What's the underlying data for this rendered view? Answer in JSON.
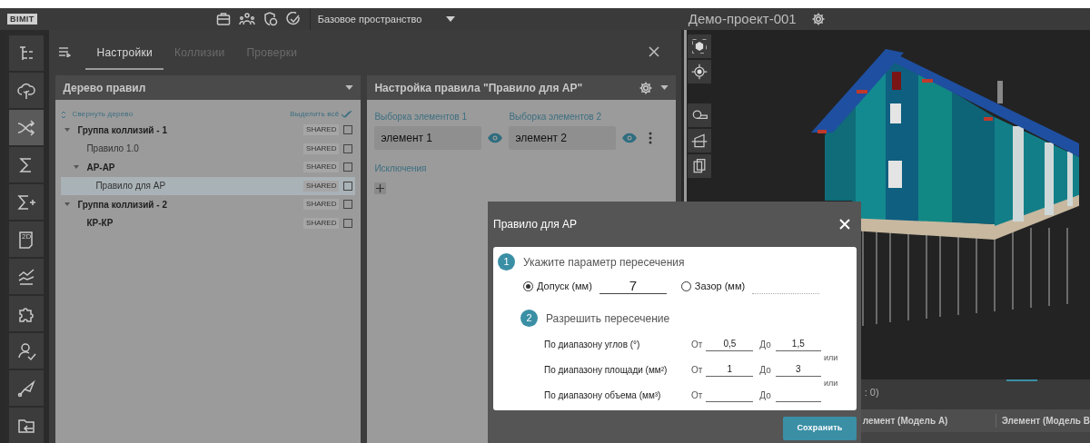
{
  "topbar": {
    "logo": "BIMIT",
    "workspace": "Базовое пространство",
    "project": "Демо-проект-001"
  },
  "rail": [
    {
      "kind": "tree",
      "selected": false
    },
    {
      "kind": "cloud",
      "selected": false
    },
    {
      "kind": "shuffle",
      "selected": true
    },
    {
      "kind": "sigma",
      "selected": false
    },
    {
      "kind": "sigmaplus",
      "selected": false
    },
    {
      "kind": "sheet",
      "label": "2D",
      "selected": false
    },
    {
      "kind": "chart",
      "selected": false
    },
    {
      "kind": "puzzle",
      "selected": false
    },
    {
      "kind": "usercheck",
      "selected": false
    },
    {
      "kind": "trowel",
      "selected": false
    },
    {
      "kind": "folder",
      "selected": false
    }
  ],
  "panel": {
    "tabs": [
      {
        "label": "Настройки",
        "selected": true
      },
      {
        "label": "Коллизии",
        "selected": false
      },
      {
        "label": "Проверки",
        "selected": false
      }
    ]
  },
  "tree_panel": {
    "title": "Дерево правил",
    "collapse": "Свернуть дерево",
    "select_all": "Выделить всё",
    "items": [
      {
        "label": "Группа коллизий - 1",
        "kind": "group",
        "badge": "SHARED",
        "checked": false,
        "selected": false,
        "expanded": true,
        "children": [
          {
            "label": "Правило 1.0",
            "kind": "rule",
            "badge": "SHARED",
            "checked": false,
            "selected": false
          },
          {
            "label": "АР-АР",
            "kind": "group",
            "badge": "SHARED",
            "checked": false,
            "selected": false,
            "expanded": true,
            "children": [
              {
                "label": "Правило для АР",
                "kind": "rule",
                "badge": "SHARED",
                "checked": false,
                "selected": true
              }
            ]
          }
        ]
      },
      {
        "label": "Группа коллизий - 2",
        "kind": "group",
        "badge": "SHARED",
        "checked": false,
        "selected": false,
        "expanded": true,
        "children": [
          {
            "label": "КР-КР",
            "kind": "group",
            "badge": "SHARED",
            "checked": false,
            "selected": false
          }
        ]
      }
    ]
  },
  "rule_panel": {
    "title": "Настройка правила \"Правило для АР\"",
    "selections": [
      {
        "label": "Выборка элементов 1",
        "value": "элемент 1"
      },
      {
        "label": "Выборка элементов 2",
        "value": "элемент 2"
      }
    ],
    "exclusions": "Исключения"
  },
  "viewer": {
    "count": ": 0)",
    "columns": [
      "лемент (Модель А)",
      "Элемент (Модель В"
    ]
  },
  "modal": {
    "title": "Правило для АР",
    "step1": {
      "number": "1",
      "title": "Укажите параметр пересечения",
      "options": [
        {
          "label": "Допуск (мм)",
          "selected": true,
          "value": "7"
        },
        {
          "label": "Зазор (мм)",
          "selected": false
        }
      ]
    },
    "step2": {
      "number": "2",
      "title": "Разрешить пересечение",
      "ranges": [
        {
          "label": "По диапазону углов (°)",
          "from_label": "От",
          "from": "0,5",
          "to_label": "До",
          "to": "1,5"
        },
        {
          "label": "По диапазону площади (мм²)",
          "from_label": "От",
          "from": "1",
          "to_label": "До",
          "to": "3",
          "suffix": "или"
        },
        {
          "label": "По диапазону объема (мм³)",
          "from_label": "От",
          "to_label": "До",
          "suffix": "или"
        }
      ]
    },
    "save": "Сохранить"
  }
}
